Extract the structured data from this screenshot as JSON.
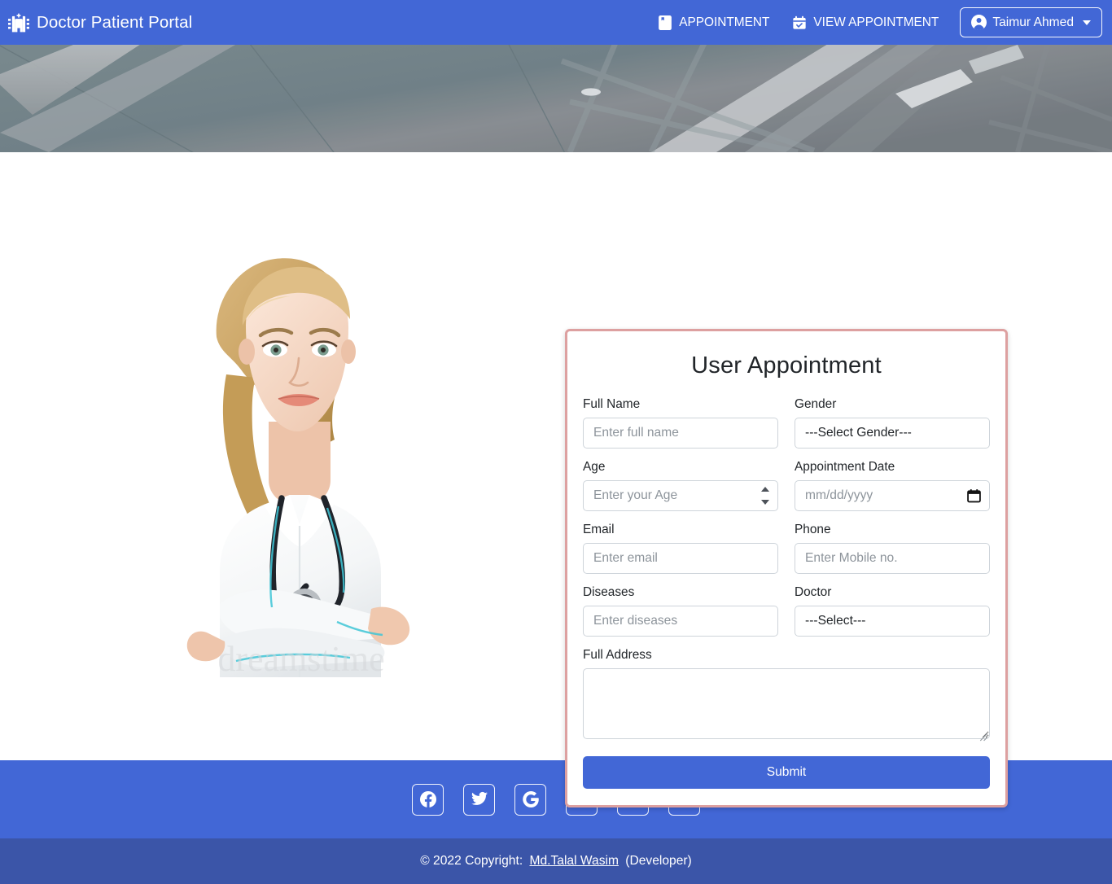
{
  "navbar": {
    "brand_label": "Doctor Patient Portal",
    "brand_icon": "hospital-icon",
    "bg_color": "#4267d6",
    "links": [
      {
        "label": "APPOINTMENT",
        "icon": "journal-icon"
      },
      {
        "label": "VIEW APPOINTMENT",
        "icon": "calendar-check-icon"
      }
    ],
    "user": {
      "name": "Taimur Ahmed",
      "icon": "person-circle-icon",
      "caret": "chevron-down-icon"
    }
  },
  "hero": {
    "alt": "hospital-ceiling-banner"
  },
  "main": {
    "doctor_image_alt": "female-doctor-with-stethoscope",
    "doctor_image_watermark": "dreamstime"
  },
  "form": {
    "title": "User Appointment",
    "border_color": "#dda0a0",
    "fields": {
      "full_name": {
        "label": "Full Name",
        "placeholder": "Enter full name",
        "value": ""
      },
      "gender": {
        "label": "Gender",
        "selected": "---Select Gender---"
      },
      "age": {
        "label": "Age",
        "placeholder": "Enter your Age",
        "value": ""
      },
      "appointment_date": {
        "label": "Appointment Date",
        "placeholder": "mm/dd/yyyy",
        "value": ""
      },
      "email": {
        "label": "Email",
        "placeholder": "Enter email",
        "value": ""
      },
      "phone": {
        "label": "Phone",
        "placeholder": "Enter Mobile no.",
        "value": ""
      },
      "diseases": {
        "label": "Diseases",
        "placeholder": "Enter diseases",
        "value": ""
      },
      "doctor": {
        "label": "Doctor",
        "selected": "---Select---"
      },
      "full_address": {
        "label": "Full Address",
        "value": ""
      }
    },
    "submit_label": "Submit",
    "submit_color": "#4267d6"
  },
  "footer": {
    "social_bg": "#4267d6",
    "bottom_bg": "#3b55a8",
    "social": [
      {
        "name": "facebook-icon"
      },
      {
        "name": "twitter-icon"
      },
      {
        "name": "google-icon"
      },
      {
        "name": "instagram-icon"
      },
      {
        "name": "linkedin-icon"
      },
      {
        "name": "github-icon"
      }
    ],
    "copyright_prefix": "© 2022 Copyright: ",
    "copyright_link": "Md.Talal Wasim",
    "copyright_suffix": " (Developer)"
  }
}
